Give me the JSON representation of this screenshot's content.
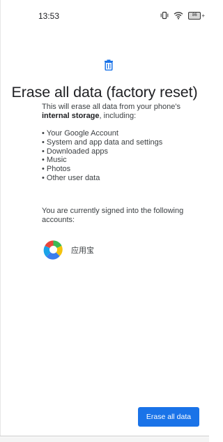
{
  "status_bar": {
    "time": "13:53",
    "battery_level": "86",
    "icons": [
      "vibrate-icon",
      "wifi-icon",
      "battery-icon"
    ]
  },
  "screen": {
    "icon": "trash-icon",
    "accent_color": "#1a73e8",
    "title": "Erase all data (factory reset)",
    "description_prefix": "This will erase all data from your phone's ",
    "description_bold": "internal storage",
    "description_suffix": ", including:",
    "items": [
      "Your Google Account",
      "System and app data and settings",
      "Downloaded apps",
      "Music",
      "Photos",
      "Other user data"
    ],
    "accounts_text": "You are currently signed into the following accounts:",
    "accounts": [
      {
        "name": "应用宝",
        "icon": "yingyongbao-app-icon"
      }
    ],
    "erase_button_label": "Erase all data"
  }
}
